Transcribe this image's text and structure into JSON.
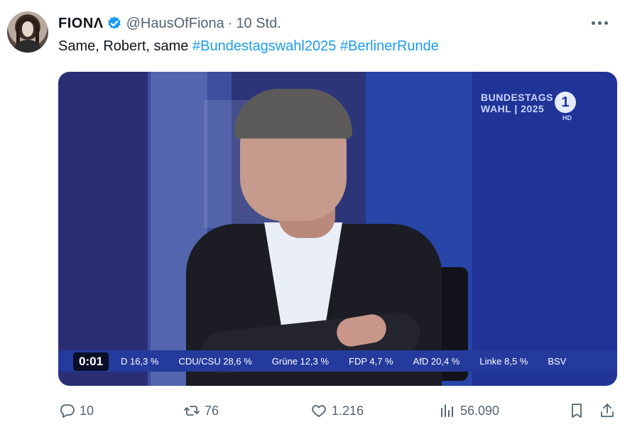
{
  "author": {
    "name": "FIONΛ",
    "handle": "@HausOfFiona",
    "separator": "·",
    "time": "10 Std."
  },
  "tweet": {
    "text_plain": "Same, Robert, same",
    "hashtags": [
      "#Bundestagswahl2025",
      "#BerlinerRunde"
    ]
  },
  "video": {
    "timestamp": "0:01",
    "logo": {
      "line1": "BUNDESTAGS",
      "line2": "WAHL | 2025",
      "channel": "1",
      "quality": "HD"
    },
    "ticker": [
      "D 16,3 %",
      "CDU/CSU 28,6 %",
      "Grüne 12,3 %",
      "FDP 4,7 %",
      "AfD 20,4 %",
      "Linke 8,5 %",
      "BSV"
    ]
  },
  "actions": {
    "replies": "10",
    "retweets": "76",
    "likes": "1.216",
    "views": "56.090"
  },
  "colors": {
    "accent": "#1d9bf0",
    "muted": "#536471",
    "ticker_bg": "#243a9c"
  },
  "icons": [
    "verified-badge-icon",
    "more-icon",
    "reply-icon",
    "retweet-icon",
    "like-icon",
    "views-icon",
    "bookmark-icon",
    "share-icon"
  ]
}
